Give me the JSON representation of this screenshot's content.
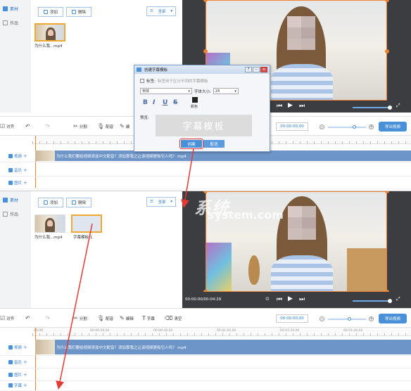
{
  "top": {
    "sidebar": {
      "items": [
        {
          "label": "素材"
        },
        {
          "label": "作品"
        }
      ]
    },
    "library": {
      "add_label": "添加",
      "delete_label": "删除",
      "filter_value": "全部",
      "items": [
        {
          "caption": "为什么我...mp4"
        }
      ]
    },
    "player": {
      "time": "00:00:00,00"
    },
    "toolbar": {
      "align_label": "对齐",
      "split_label": "分割",
      "dub_label": "配音",
      "edit_label": "编",
      "export_label": "导出视频"
    },
    "tracks": [
      {
        "label": "视频"
      },
      {
        "label": "音乐"
      },
      {
        "label": "图片"
      }
    ],
    "video_clip_text": "为什么我们要给视频添加中文配音？添加那我之让该视频更吸引人吗？ mp4",
    "dialog": {
      "title": "创建字幕模板",
      "label_label": "标签:",
      "label_placeholder": "标签用于区分不同的字幕模板",
      "font_value": "宋体",
      "size_label": "字体大小:",
      "size_value": "24",
      "color_label": "颜色",
      "bold": "B",
      "italic": "I",
      "underline": "U",
      "strike": "S",
      "preview_label": "预览:",
      "preview_text": "字幕模板",
      "create_label": "创建",
      "cancel_label": "取消"
    }
  },
  "bottom": {
    "sidebar": {
      "items": [
        {
          "label": "素材"
        },
        {
          "label": "作品"
        }
      ]
    },
    "library": {
      "add_label": "添加",
      "delete_label": "删除",
      "filter_value": "全部",
      "items": [
        {
          "caption": "为什么我...mp4"
        },
        {
          "caption": "字幕模板-1"
        }
      ]
    },
    "player": {
      "time": "00:00:00/00:04:29"
    },
    "toolbar": {
      "align_label": "对齐",
      "split_label": "分割",
      "dub_label": "配音",
      "edit_label": "编辑",
      "subtitle_label": "字幕",
      "clear_label": "清空",
      "time_value": "00:00:00,00",
      "export_label": "导出视频"
    },
    "ruler": [
      "00:00",
      "00:00:20,00",
      "00:00:40,00",
      "00:01:00,00",
      "00:01:20,00",
      "00:01:40,00"
    ],
    "tracks": [
      {
        "label": "视频"
      },
      {
        "label": "音乐"
      },
      {
        "label": "图片"
      },
      {
        "label": "字幕"
      }
    ],
    "video_clip_text": "为什么我们要给视频添加中文配音？添加那我之让该视频更吸引人吗？ mp4"
  },
  "watermark": {
    "line1": "系统",
    "line2": "system.com"
  },
  "colors": {
    "accent": "#4a90d9",
    "highlight": "#f08030",
    "annotation": "#e53935",
    "player_bg": "#3b3d40"
  }
}
